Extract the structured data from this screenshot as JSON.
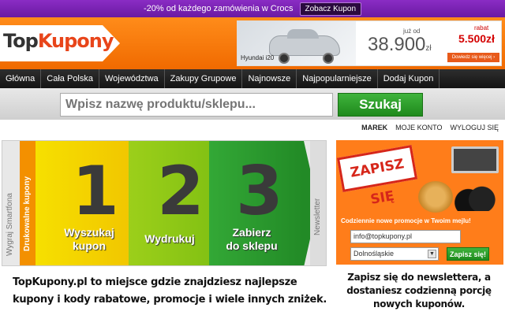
{
  "promo": {
    "text": "-20% od każdego zamówienia w Crocs",
    "button": "Zobacz Kupon"
  },
  "logo": {
    "part1": "Top",
    "part2": "Kupony"
  },
  "ad": {
    "model": "Hyundai i20",
    "price_label": "już od",
    "price": "38.900",
    "currency": "zł",
    "discount_label": "rabat",
    "discount": "5.500zł",
    "cta": "Dowiedz się więcej ›"
  },
  "nav": {
    "items": [
      "Główna",
      "Cała Polska",
      "Województwa",
      "Zakupy Grupowe",
      "Najnowsze",
      "Najpopularniejsze",
      "Dodaj Kupon"
    ]
  },
  "search": {
    "placeholder": "Wpisz nazwę produktu/sklepu...",
    "button": "Szukaj"
  },
  "user": {
    "name": "MAREK",
    "account": "MOJE KONTO",
    "logout": "WYLOGUJ SIĘ"
  },
  "steps": {
    "left_label": "Wygraj Smartfona",
    "orange_label": "Drukowalne kupony",
    "right_label": "Newsletter",
    "items": [
      {
        "num": "1",
        "line1": "Wyszukaj",
        "line2": "kupon"
      },
      {
        "num": "2",
        "line1": "Wydrukuj",
        "line2": ""
      },
      {
        "num": "3",
        "line1": "Zabierz",
        "line2": "do sklepu"
      }
    ]
  },
  "tagline": "TopKupony.pl to miejsce gdzie znajdziesz najlepsze kupony i kody rabatowe, promocje i wiele innych zniżek.",
  "newsletter": {
    "stamp": "ZAPISZ SIĘ",
    "caption": "Codziennie nowe promocje w Twoim mejlu!",
    "email": "info@topkupony.pl",
    "region": "Dolnośląskie",
    "submit": "Zapisz się!",
    "text": "Zapisz się do newslettera, a dostaniesz codzienną porcję nowych kuponów."
  },
  "colors": {
    "promo_bar": "#7a24b4",
    "header_orange": "#f57a0c",
    "nav_dark": "#1e1e1e",
    "search_green": "#2c9e29"
  }
}
